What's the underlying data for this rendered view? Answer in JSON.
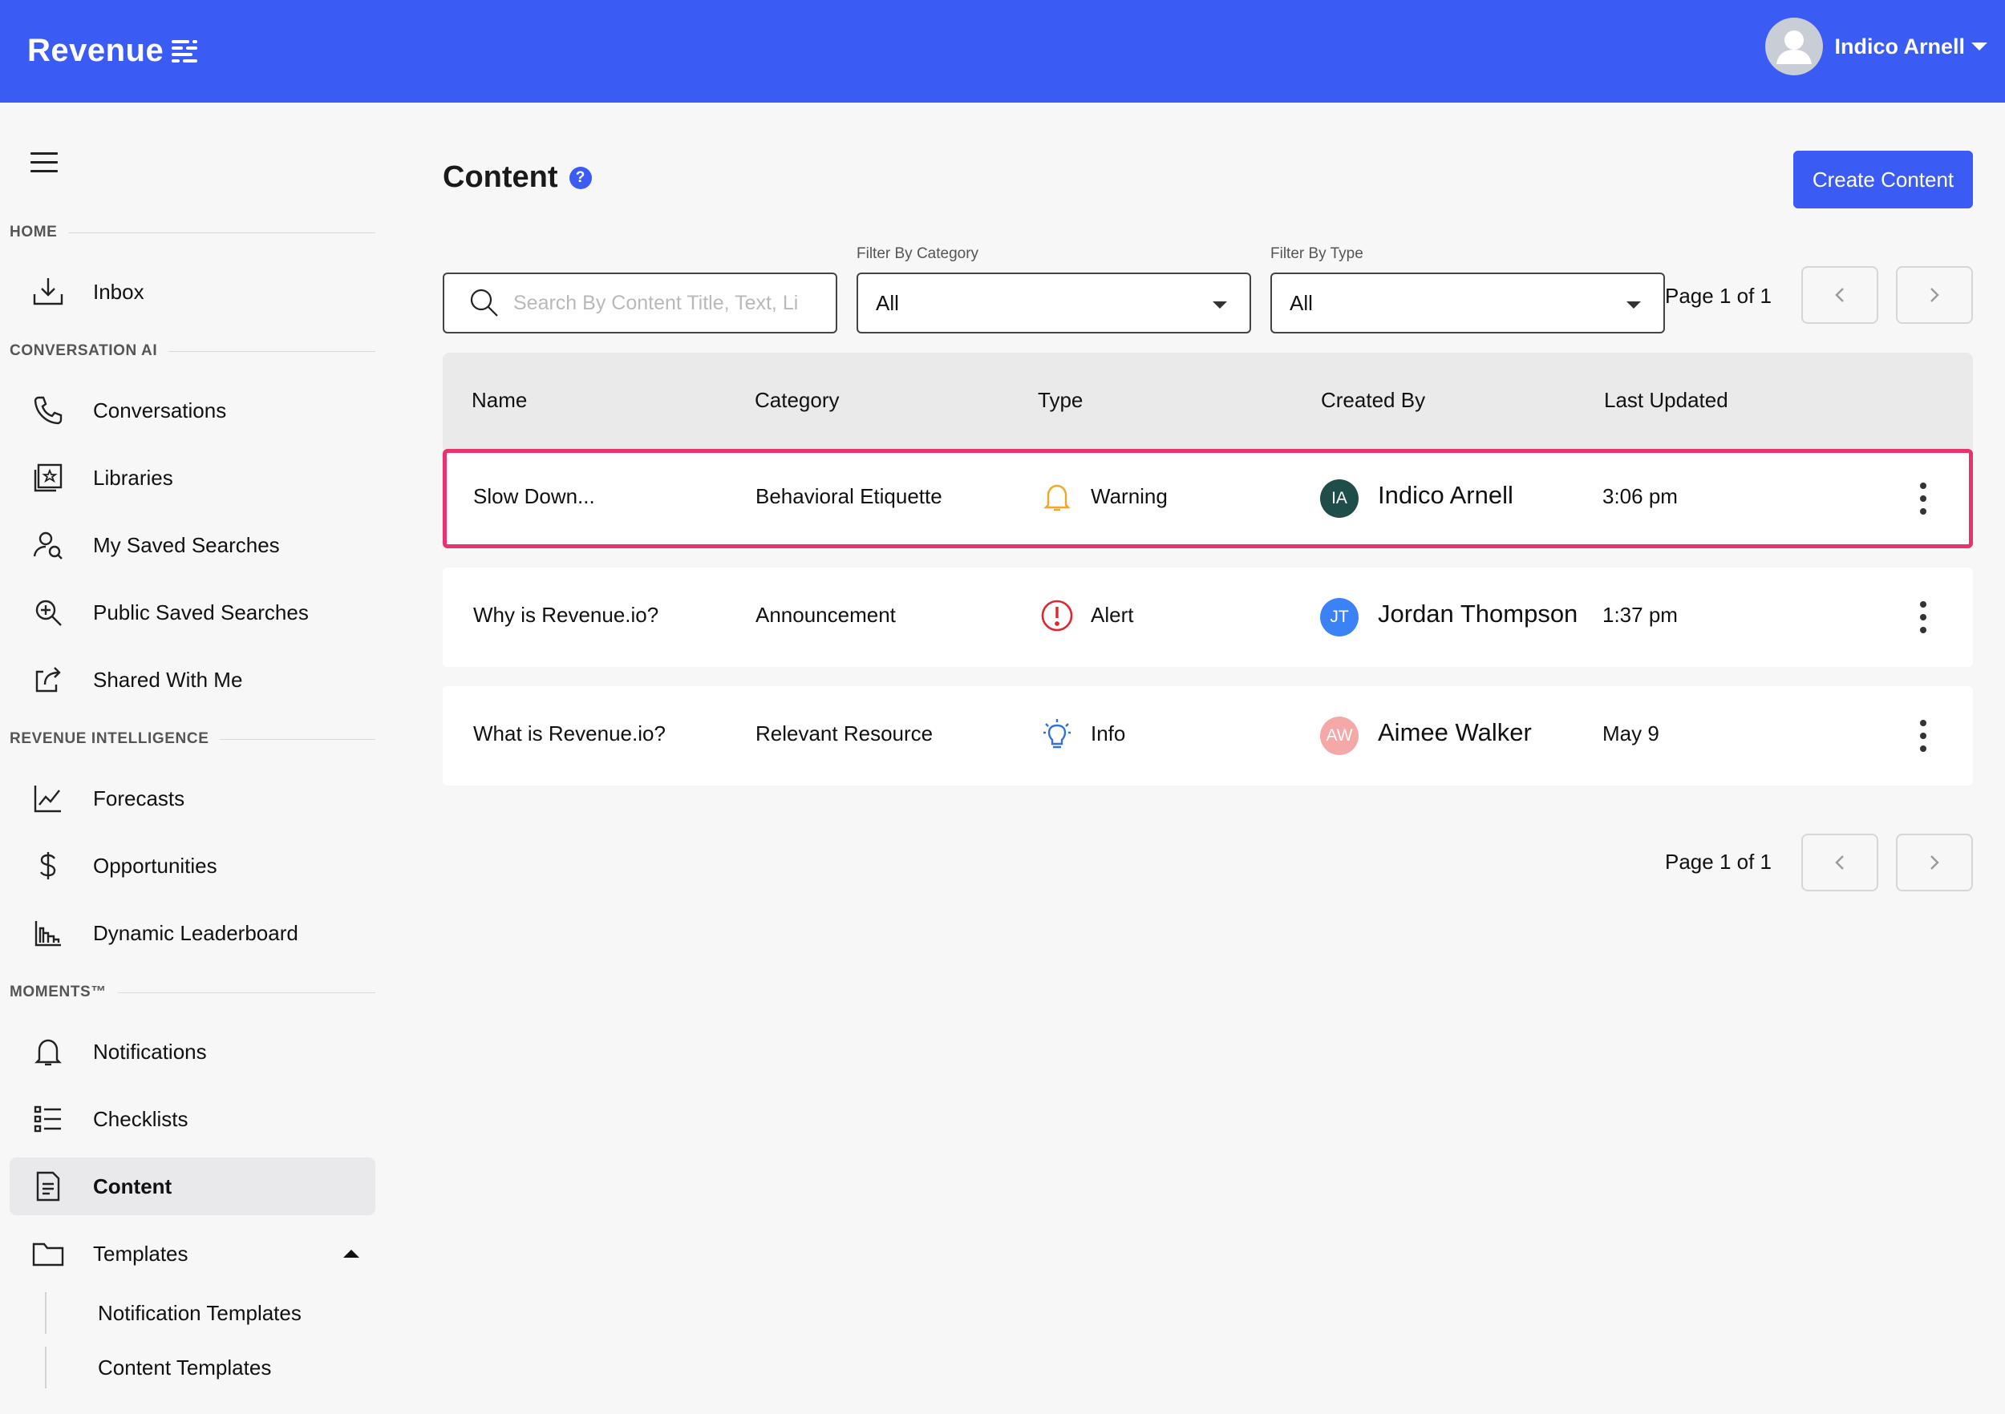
{
  "header": {
    "logo_text": "Revenue",
    "user_name": "Indico Arnell"
  },
  "sidebar": {
    "sections": {
      "home": "HOME",
      "conversation_ai": "CONVERSATION AI",
      "revenue_intelligence": "REVENUE INTELLIGENCE",
      "moments": "MOMENTS™"
    },
    "items": {
      "inbox": "Inbox",
      "conversations": "Conversations",
      "libraries": "Libraries",
      "my_saved_searches": "My Saved Searches",
      "public_saved_searches": "Public Saved Searches",
      "shared_with_me": "Shared With Me",
      "forecasts": "Forecasts",
      "opportunities": "Opportunities",
      "dynamic_leaderboard": "Dynamic Leaderboard",
      "notifications": "Notifications",
      "checklists": "Checklists",
      "content": "Content",
      "templates": "Templates",
      "notification_templates": "Notification Templates",
      "content_templates": "Content Templates"
    }
  },
  "main": {
    "title": "Content",
    "help": "?",
    "create_button": "Create Content",
    "search_placeholder": "Search By Content Title, Text, Li",
    "filter_category_label": "Filter By Category",
    "filter_category_value": "All",
    "filter_type_label": "Filter By Type",
    "filter_type_value": "All",
    "pagination": "Page 1 of 1",
    "columns": {
      "name": "Name",
      "category": "Category",
      "type": "Type",
      "created_by": "Created By",
      "last_updated": "Last Updated"
    },
    "rows": [
      {
        "name": "Slow Down...",
        "category": "Behavioral Etiquette",
        "type": "Warning",
        "type_icon": "bell-icon",
        "type_color": "#f5a623",
        "initials": "IA",
        "initials_color": "#1e4d4a",
        "created_by": "Indico Arnell",
        "last_updated": "3:06 pm"
      },
      {
        "name": "Why is Revenue.io?",
        "category": "Announcement",
        "type": "Alert",
        "type_icon": "alert-circle-icon",
        "type_color": "#e0262f",
        "initials": "JT",
        "initials_color": "#3b82f6",
        "created_by": "Jordan Thompson",
        "last_updated": "1:37 pm"
      },
      {
        "name": "What is Revenue.io?",
        "category": "Relevant Resource",
        "type": "Info",
        "type_icon": "lightbulb-icon",
        "type_color": "#2f6fdf",
        "initials": "AW",
        "initials_color": "#f5a8a8",
        "created_by": "Aimee Walker",
        "last_updated": "May 9"
      }
    ],
    "highlight_color": "#e8336d"
  }
}
